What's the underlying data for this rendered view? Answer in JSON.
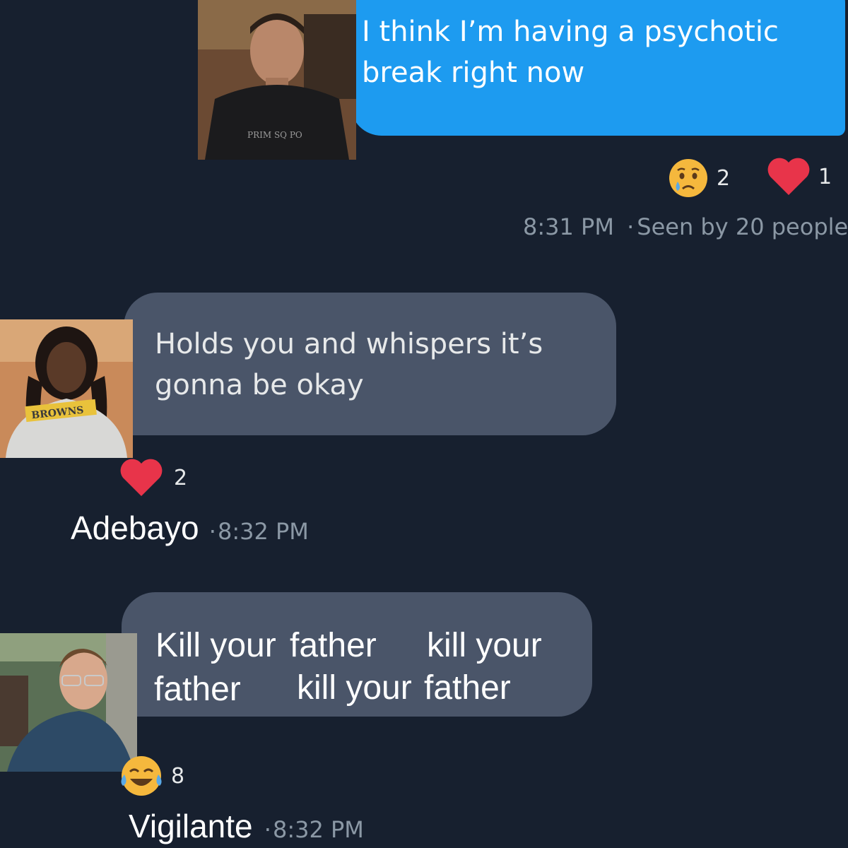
{
  "colors": {
    "background": "#17202f",
    "sent_bubble": "#1d9bf0",
    "received_bubble": "#4a5569",
    "meta_text": "#8b98a5",
    "heart": "#f91880"
  },
  "messages": [
    {
      "kind": "sent",
      "text": "I think I’m having a psychotic break right now",
      "reactions": [
        {
          "icon": "crying-face-emoji",
          "count": "2"
        },
        {
          "icon": "heart-icon",
          "count": "1"
        }
      ],
      "time": "8:31 PM",
      "separator": "·",
      "seen": "Seen by 20 people"
    },
    {
      "kind": "received",
      "text": "Holds you and whispers it’s gonna be okay",
      "reactions": [
        {
          "icon": "heart-icon",
          "count": "2"
        }
      ],
      "sender": "Adebayo",
      "separator": "·",
      "time": "8:32 PM"
    },
    {
      "kind": "received",
      "fragments": [
        "Kill your",
        "father",
        "kill your",
        "father",
        "kill your",
        "father"
      ],
      "reactions": [
        {
          "icon": "laughing-tears-emoji",
          "count": "8"
        }
      ],
      "sender": "Vigilante",
      "separator": "·",
      "time": "8:32 PM"
    }
  ],
  "avatars": [
    {
      "icon": "avatar-man-dark-shirt"
    },
    {
      "icon": "avatar-woman-graphic-tee"
    },
    {
      "icon": "avatar-man-glasses"
    }
  ]
}
